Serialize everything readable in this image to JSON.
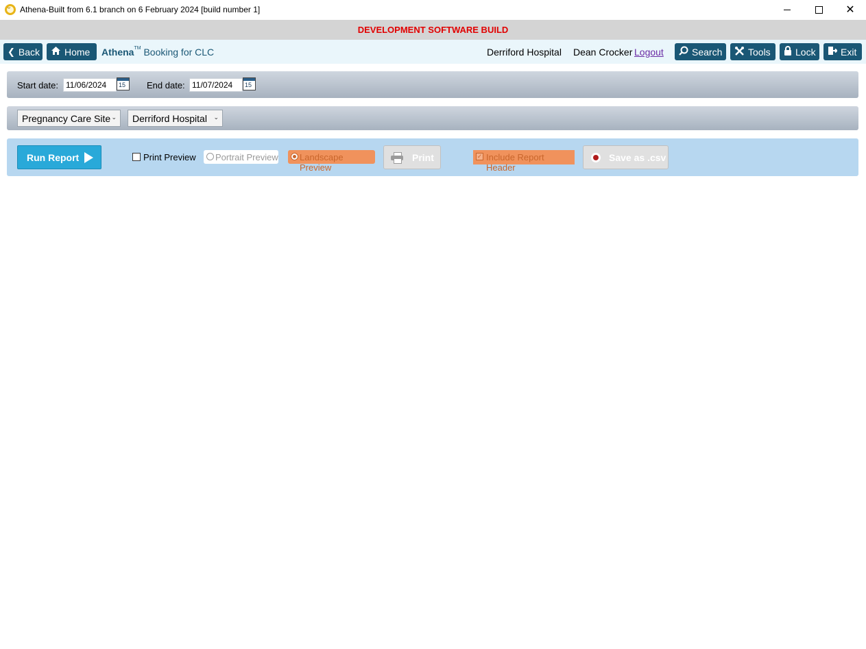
{
  "window": {
    "title": "Athena-Built from 6.1 branch on 6 February 2024 [build number 1]",
    "app_icon": "athena-logo-icon"
  },
  "banner": {
    "text": "DEVELOPMENT SOFTWARE BUILD",
    "color": "#e10000"
  },
  "nav": {
    "back_label": "Back",
    "home_label": "Home",
    "brand_name": "Athena",
    "brand_tm": "TM",
    "page_title": "Booking for CLC",
    "hospital": "Derriford Hospital",
    "user": "Dean Crocker",
    "logout_label": "Logout",
    "search_label": "Search",
    "tools_label": "Tools",
    "lock_label": "Lock",
    "exit_label": "Exit",
    "accent": "#1a5775"
  },
  "dates": {
    "start_label": "Start date:",
    "start_value": "11/06/2024",
    "end_label": "End date:",
    "end_value": "11/07/2024",
    "calendar_day": "15"
  },
  "filters": {
    "site_type": "Pregnancy Care Site",
    "site": "Derriford Hospital"
  },
  "actions": {
    "run_label": "Run Report",
    "print_preview_label": "Print Preview",
    "print_preview_checked": false,
    "portrait_label": "Portrait Preview",
    "landscape_label": "Landscape Preview",
    "print_label": "Print",
    "include_header_label": "Include Report Header",
    "include_header_checked": true,
    "csv_label": "Save as .csv",
    "run_color": "#29a9d9",
    "highlight_color": "#f0925c"
  }
}
